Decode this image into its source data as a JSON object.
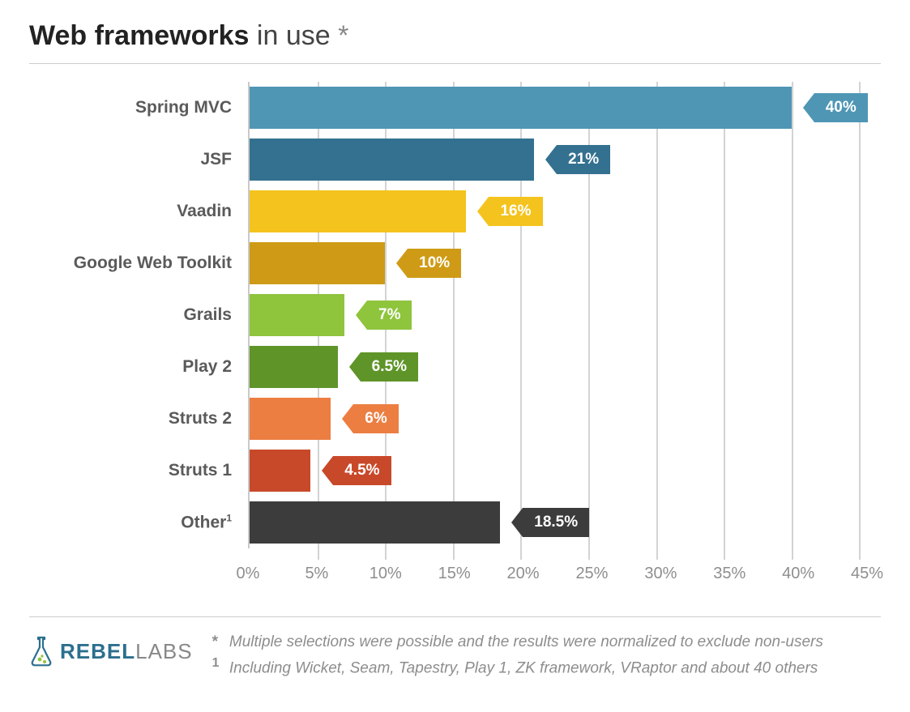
{
  "title_bold": "Web frameworks",
  "title_rest": " in use ",
  "title_asterisk": "*",
  "footer": {
    "logo_brand": "REBEL",
    "logo_sub": "LABS",
    "note1_marker": "*",
    "note1": "Multiple selections were possible and the results were normalized to exclude non-users",
    "note2_marker": "1",
    "note2": "Including Wicket, Seam, Tapestry, Play 1, ZK framework, VRaptor and about 40 others"
  },
  "chart_data": {
    "type": "bar",
    "orientation": "horizontal",
    "title": "Web frameworks in use *",
    "xlabel": "",
    "ylabel": "",
    "xlim": [
      0,
      46
    ],
    "xticks": [
      0,
      5,
      10,
      15,
      20,
      25,
      30,
      35,
      40,
      45
    ],
    "xtick_labels": [
      "0%",
      "5%",
      "10%",
      "15%",
      "20%",
      "25%",
      "30%",
      "35%",
      "40%",
      "45%"
    ],
    "categories": [
      "Spring MVC",
      "JSF",
      "Vaadin",
      "Google Web Toolkit",
      "Grails",
      "Play 2",
      "Struts 2",
      "Struts 1",
      "Other¹"
    ],
    "values": [
      40,
      21,
      16,
      10,
      7,
      6.5,
      6,
      4.5,
      18.5
    ],
    "value_labels": [
      "40%",
      "21%",
      "16%",
      "10%",
      "7%",
      "6.5%",
      "6%",
      "4.5%",
      "18.5%"
    ],
    "colors": [
      "#4f96b5",
      "#347190",
      "#f4c31d",
      "#cf9b16",
      "#8fc43d",
      "#5f9429",
      "#ec7e42",
      "#c8492a",
      "#3c3c3c"
    ],
    "label_offsets": [
      14,
      14,
      14,
      14,
      14,
      14,
      14,
      14,
      14
    ]
  }
}
